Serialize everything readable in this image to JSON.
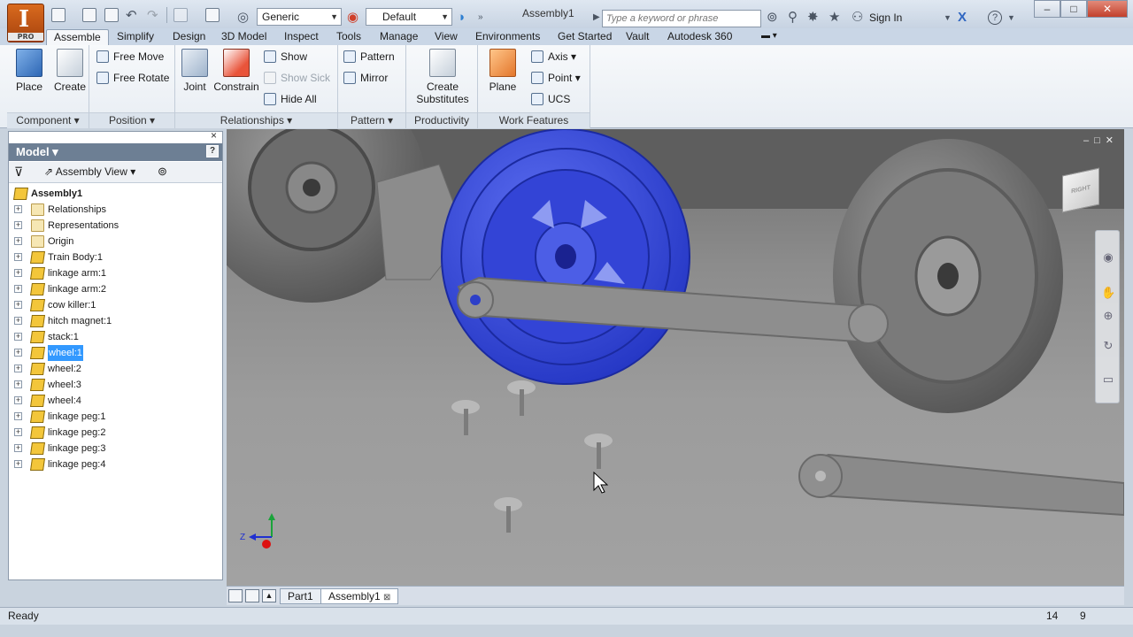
{
  "app": {
    "badge": "PRO",
    "title": "Assembly1",
    "style_combo": "Generic",
    "appearance_combo": "Default",
    "search_placeholder": "Type a keyword or phrase",
    "sign_in": "Sign In",
    "help": "?"
  },
  "menu_tabs": [
    "Assemble",
    "Simplify",
    "Design",
    "3D Model",
    "Inspect",
    "Tools",
    "Manage",
    "View",
    "Environments",
    "Get Started",
    "Vault",
    "Autodesk 360"
  ],
  "active_tab": "Assemble",
  "ribbon": {
    "component": {
      "label": "Component",
      "place": "Place",
      "create": "Create"
    },
    "position": {
      "label": "Position",
      "free_move": "Free Move",
      "free_rotate": "Free Rotate"
    },
    "relationships": {
      "label": "Relationships",
      "joint": "Joint",
      "constrain": "Constrain",
      "show": "Show",
      "show_sick": "Show Sick",
      "hide_all": "Hide All"
    },
    "pattern": {
      "label": "Pattern",
      "pattern": "Pattern",
      "mirror": "Mirror"
    },
    "productivity": {
      "label": "Productivity",
      "create_substitutes_1": "Create",
      "create_substitutes_2": "Substitutes"
    },
    "work_features": {
      "label": "Work Features",
      "plane": "Plane",
      "axis": "Axis",
      "point": "Point",
      "ucs": "UCS"
    }
  },
  "browser": {
    "title": "Model",
    "view": "Assembly View",
    "help": "?",
    "close": "×",
    "items": [
      {
        "label": "Assembly1",
        "icon": "assembly-icon",
        "root": true
      },
      {
        "label": "Relationships",
        "icon": "folder-icon"
      },
      {
        "label": "Representations",
        "icon": "representations-icon"
      },
      {
        "label": "Origin",
        "icon": "folder-icon"
      },
      {
        "label": "Train Body:1",
        "icon": "subassembly-icon"
      },
      {
        "label": "linkage arm:1",
        "icon": "part-icon"
      },
      {
        "label": "linkage arm:2",
        "icon": "part-icon"
      },
      {
        "label": "cow killer:1",
        "icon": "part-icon"
      },
      {
        "label": "hitch magnet:1",
        "icon": "part-icon"
      },
      {
        "label": "stack:1",
        "icon": "part-icon"
      },
      {
        "label": "wheel:1",
        "icon": "part-icon",
        "selected": true
      },
      {
        "label": "wheel:2",
        "icon": "part-icon"
      },
      {
        "label": "wheel:3",
        "icon": "part-icon"
      },
      {
        "label": "wheel:4",
        "icon": "part-icon"
      },
      {
        "label": "linkage peg:1",
        "icon": "part-icon"
      },
      {
        "label": "linkage peg:2",
        "icon": "part-icon"
      },
      {
        "label": "linkage peg:3",
        "icon": "part-icon"
      },
      {
        "label": "linkage peg:4",
        "icon": "part-icon"
      }
    ]
  },
  "viewport": {
    "viewcube_face": "RIGHT",
    "axis_z": "Z"
  },
  "doc_tabs": [
    "Part1",
    "Assembly1"
  ],
  "active_doc": "Assembly1",
  "status": {
    "text": "Ready",
    "num1": "14",
    "num2": "9"
  },
  "colors": {
    "selection_blue": "#3b4fd8",
    "accent_orange": "#c8561a",
    "tree_selection": "#3399ff"
  }
}
